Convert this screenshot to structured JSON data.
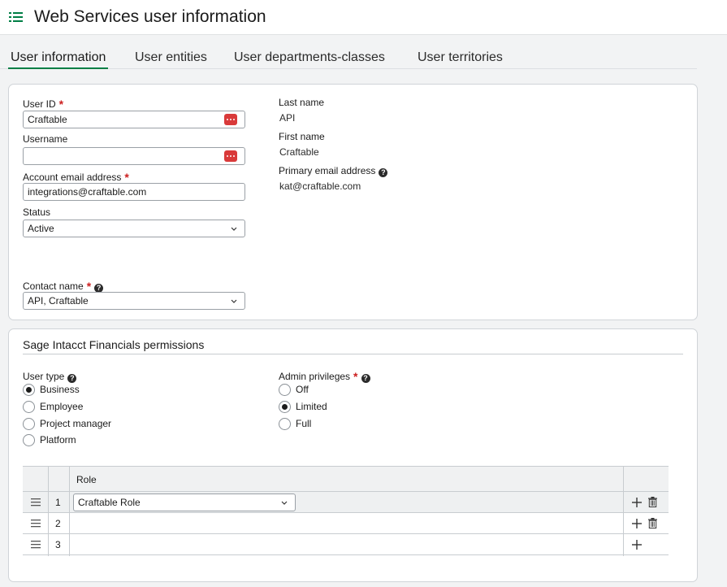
{
  "header": {
    "title": "Web Services user information"
  },
  "tabs": [
    {
      "label": "User information",
      "active": true
    },
    {
      "label": "User entities",
      "active": false
    },
    {
      "label": "User departments-classes",
      "active": false
    },
    {
      "label": "User territories",
      "active": false
    }
  ],
  "user_info": {
    "user_id_label": "User ID",
    "user_id_value": "Craftable",
    "username_label": "Username",
    "username_value": "",
    "account_email_label": "Account email address",
    "account_email_value": "integrations@craftable.com",
    "status_label": "Status",
    "status_value": "Active",
    "contact_name_label": "Contact name",
    "contact_name_value": "API, Craftable",
    "last_name_label": "Last name",
    "last_name_value": "API",
    "first_name_label": "First name",
    "first_name_value": "Craftable",
    "primary_email_label": "Primary email address",
    "primary_email_value": "kat@craftable.com",
    "required_mark": "*",
    "help_mark": "?"
  },
  "permissions": {
    "title": "Sage Intacct Financials permissions",
    "user_type_label": "User type",
    "user_type_options": [
      {
        "label": "Business",
        "selected": true
      },
      {
        "label": "Employee",
        "selected": false
      },
      {
        "label": "Project manager",
        "selected": false
      },
      {
        "label": "Platform",
        "selected": false
      }
    ],
    "admin_label": "Admin privileges",
    "admin_options": [
      {
        "label": "Off",
        "selected": false
      },
      {
        "label": "Limited",
        "selected": true
      },
      {
        "label": "Full",
        "selected": false
      }
    ],
    "roles_table": {
      "column_header": "Role",
      "rows": [
        {
          "num": "1",
          "role": "Craftable Role"
        },
        {
          "num": "2",
          "role": ""
        },
        {
          "num": "3",
          "role": ""
        }
      ]
    }
  },
  "colors": {
    "accent": "#007e45",
    "required": "#cc1f1f",
    "password_button": "#d93a3a"
  }
}
